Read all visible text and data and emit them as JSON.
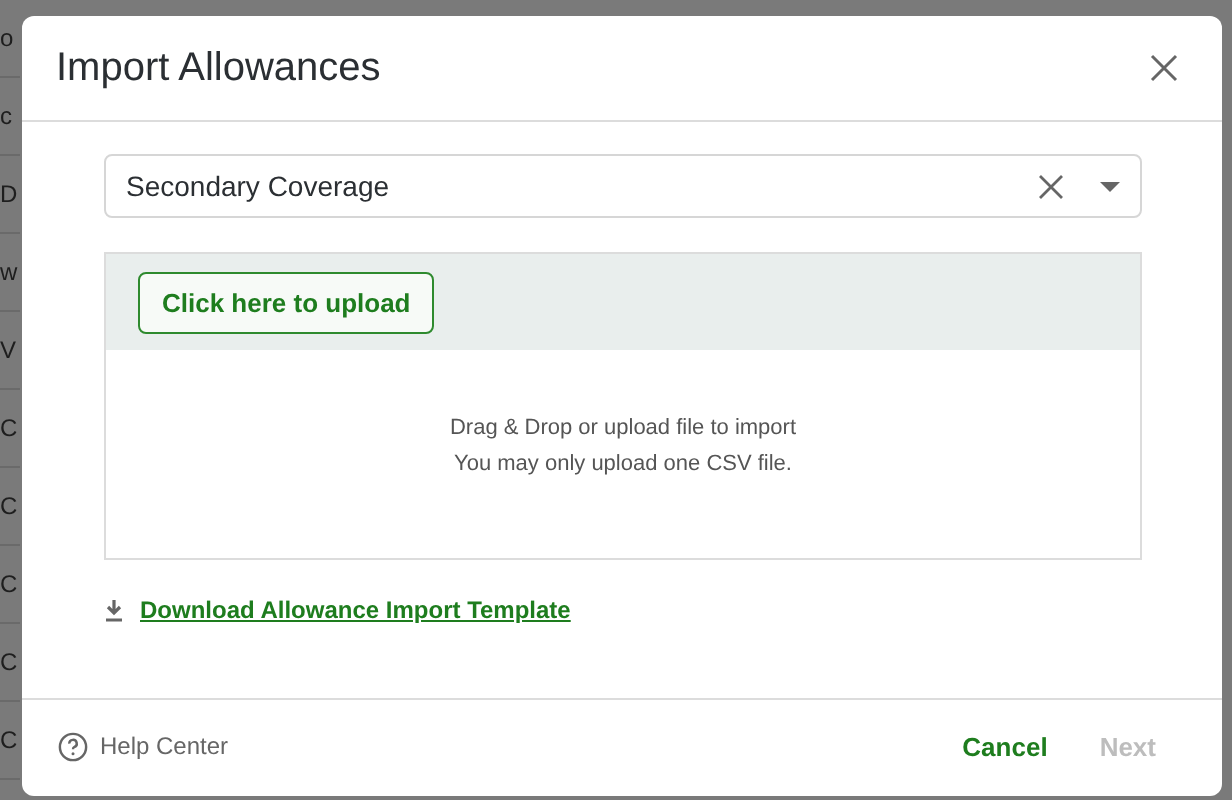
{
  "background_rows": [
    "o",
    "c",
    "D",
    "w",
    "V",
    "C",
    "C",
    "C",
    "C",
    "C"
  ],
  "dialog": {
    "title": "Import Allowances",
    "coverage_select": {
      "value": "Secondary Coverage"
    },
    "upload": {
      "button": "Click here to upload",
      "lines": [
        "Drag & Drop or upload file to import",
        "You may only upload one CSV file."
      ]
    },
    "template_link": "Download Allowance Import Template",
    "help_link": "Help Center",
    "buttons": [
      {
        "label": "Cancel",
        "disabled": false
      },
      {
        "label": "Next",
        "disabled": true
      }
    ]
  }
}
